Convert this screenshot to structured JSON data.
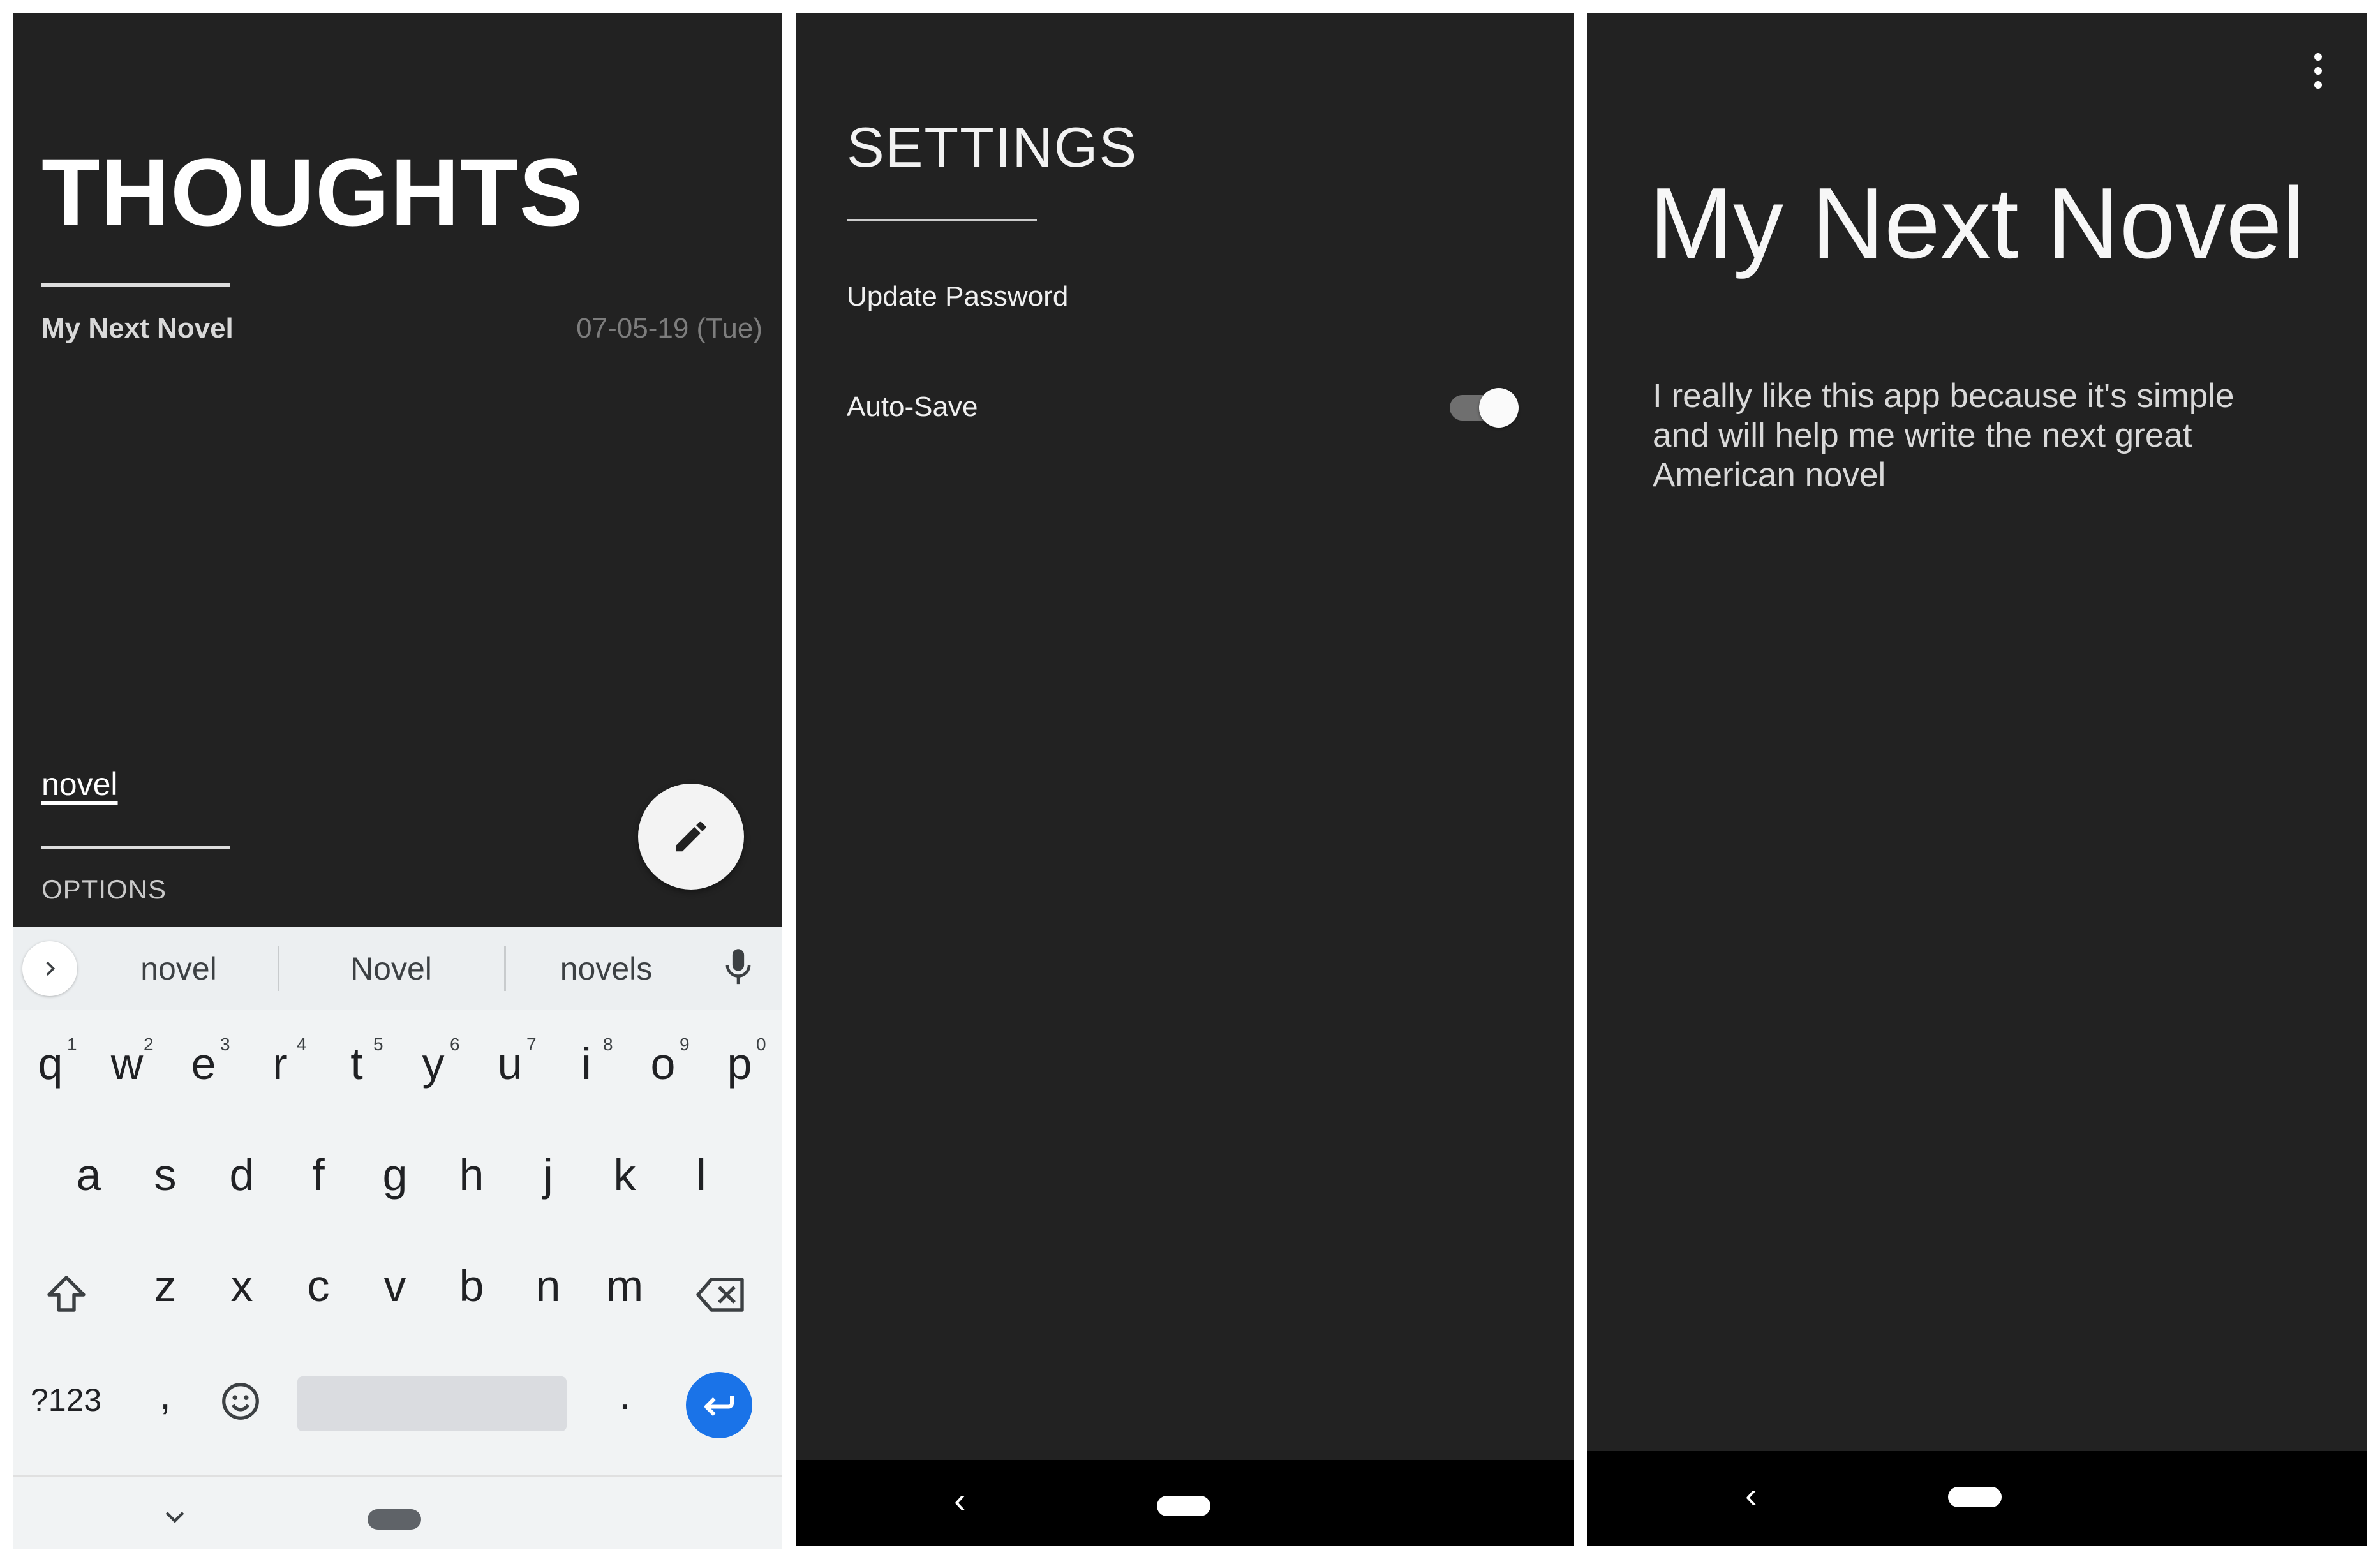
{
  "thoughts": {
    "title": "THOUGHTS",
    "note": {
      "title": "My Next Novel",
      "date": "07-05-19 (Tue)"
    },
    "search_term": "novel",
    "options_label": "OPTIONS",
    "fab_icon": "pencil-icon"
  },
  "keyboard": {
    "suggestions": [
      "novel",
      "Novel",
      "novels"
    ],
    "row1": [
      "q",
      "w",
      "e",
      "r",
      "t",
      "y",
      "u",
      "i",
      "o",
      "p"
    ],
    "row1_hints": [
      "1",
      "2",
      "3",
      "4",
      "5",
      "6",
      "7",
      "8",
      "9",
      "0"
    ],
    "row2": [
      "a",
      "s",
      "d",
      "f",
      "g",
      "h",
      "j",
      "k",
      "l"
    ],
    "row3": [
      "z",
      "x",
      "c",
      "v",
      "b",
      "n",
      "m"
    ],
    "symbols_label": "?123",
    "comma": ",",
    "period": ".",
    "accent_color": "#1a73e8"
  },
  "settings": {
    "title": "SETTINGS",
    "update_password": "Update Password",
    "auto_save": "Auto-Save",
    "auto_save_on": true
  },
  "note_view": {
    "title": "My Next Novel",
    "body": "I really like this app because it's simple and will help me write the next great American novel"
  },
  "nav": {
    "back_symbol": "‹"
  }
}
